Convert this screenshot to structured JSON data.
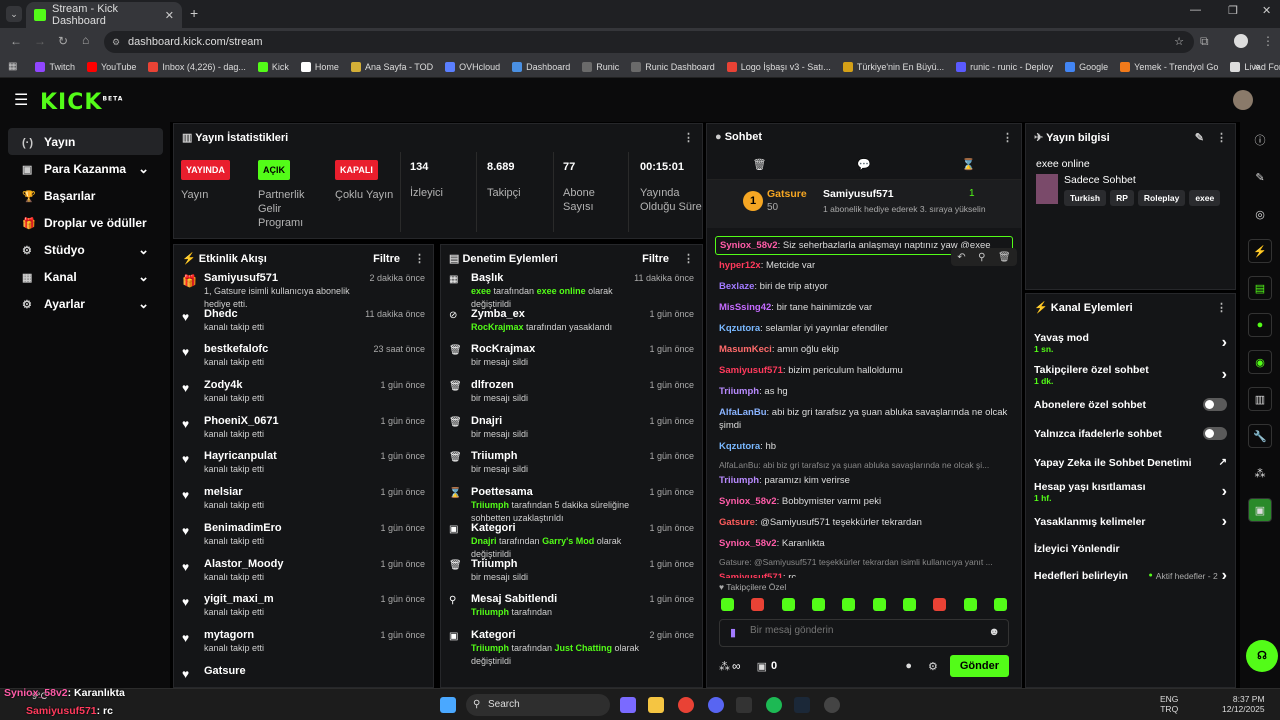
{
  "browser": {
    "tab_title": "Stream - Kick Dashboard",
    "url": "dashboard.kick.com/stream",
    "bookmarks": [
      "Twitch",
      "YouTube",
      "Inbox (4,226) - dag...",
      "Kick",
      "Home",
      "Ana Sayfa - TOD",
      "OVHcloud",
      "Dashboard",
      "Runic",
      "Runic Dashboard",
      "Logo İşbaşı v3 - Satı...",
      "Türkiye'nin En Büyü...",
      "runic - runic - Deploy",
      "Google",
      "Yemek - Trendyol Go",
      "Livad For Streamers"
    ]
  },
  "kick": {
    "logo": "KICK",
    "logo_sup": "BETA"
  },
  "sidebar": [
    "Yayın",
    "Para Kazanma",
    "Başarılar",
    "Droplar ve ödüller",
    "Stüdyo",
    "Kanal",
    "Ayarlar"
  ],
  "stats": {
    "title": "Yayın İstatistikleri",
    "badges": [
      {
        "badge": "YAYINDA",
        "label": "Yayın"
      },
      {
        "badge": "AÇIK",
        "label": "Partnerlik Gelir Programı"
      },
      {
        "badge": "KAPALI",
        "label": "Çoklu Yayın"
      }
    ],
    "numbers": [
      {
        "value": "134",
        "label": "İzleyici"
      },
      {
        "value": "8.689",
        "label": "Takipçi"
      },
      {
        "value": "77",
        "label": "Abone Sayısı"
      },
      {
        "value": "00:15:01",
        "label": "Yayında Olduğu Süre"
      }
    ]
  },
  "activity": {
    "title": "Etkinlik Akışı",
    "filter": "Filtre",
    "items": [
      {
        "name": "Samiyusuf571",
        "sub": "1, Gatsure isimli kullanıcıya abonelik hediye etti.",
        "time": "2 dakika önce"
      },
      {
        "name": "Dhedc",
        "sub": "kanalı takip etti",
        "time": "11 dakika önce"
      },
      {
        "name": "bestkefalofc",
        "sub": "kanalı takip etti",
        "time": "23 saat önce"
      },
      {
        "name": "Zody4k",
        "sub": "kanalı takip etti",
        "time": "1 gün önce"
      },
      {
        "name": "PhoeniX_0671",
        "sub": "kanalı takip etti",
        "time": "1 gün önce"
      },
      {
        "name": "Hayricanpulat",
        "sub": "kanalı takip etti",
        "time": "1 gün önce"
      },
      {
        "name": "melsiar",
        "sub": "kanalı takip etti",
        "time": "1 gün önce"
      },
      {
        "name": "BenimadimEro",
        "sub": "kanalı takip etti",
        "time": "1 gün önce"
      },
      {
        "name": "Alastor_Moody",
        "sub": "kanalı takip etti",
        "time": "1 gün önce"
      },
      {
        "name": "yigit_maxi_m",
        "sub": "kanalı takip etti",
        "time": "1 gün önce"
      },
      {
        "name": "mytagorn",
        "sub": "kanalı takip etti",
        "time": "1 gün önce"
      },
      {
        "name": "Gatsure",
        "sub": "",
        "time": ""
      }
    ]
  },
  "moderation": {
    "title": "Denetim Eylemleri",
    "filter": "Filtre",
    "items": [
      {
        "icon": "▦",
        "name": "Başlık",
        "pre": "exee",
        "mid": " tarafından ",
        "post": "exee online",
        "tail": " olarak değiştirildi",
        "time": "11 dakika önce"
      },
      {
        "icon": "⊘",
        "name": "Zymba_ex",
        "pre": "RocKrajmax",
        "mid": " tarafından yasaklandı",
        "post": "",
        "tail": "",
        "time": "1 gün önce"
      },
      {
        "icon": "🗑",
        "name": "RocKrajmax",
        "pre": "",
        "mid": "bir mesajı sildi",
        "post": "",
        "tail": "",
        "time": "1 gün önce"
      },
      {
        "icon": "🗑",
        "name": "dlfrozen",
        "pre": "",
        "mid": "bir mesajı sildi",
        "post": "",
        "tail": "",
        "time": "1 gün önce"
      },
      {
        "icon": "🗑",
        "name": "Dnajri",
        "pre": "",
        "mid": "bir mesajı sildi",
        "post": "",
        "tail": "",
        "time": "1 gün önce"
      },
      {
        "icon": "🗑",
        "name": "Triiumph",
        "pre": "",
        "mid": "bir mesajı sildi",
        "post": "",
        "tail": "",
        "time": "1 gün önce"
      },
      {
        "icon": "⌛",
        "name": "Poettesama",
        "pre": "Triiumph",
        "mid": " tarafından 5 dakika süreliğine sohbetten uzaklaştırıldı",
        "post": "",
        "tail": "",
        "time": "1 gün önce"
      },
      {
        "icon": "▣",
        "name": "Kategori",
        "pre": "Dnajri",
        "mid": " tarafından ",
        "post": "Garry's Mod",
        "tail": " olarak değiştirildi",
        "time": "1 gün önce"
      },
      {
        "icon": "🗑",
        "name": "Triiumph",
        "pre": "",
        "mid": "bir mesajı sildi",
        "post": "",
        "tail": "",
        "time": "1 gün önce"
      },
      {
        "icon": "⚲",
        "name": "Mesaj Sabitlendi",
        "pre": "Triiumph",
        "mid": " tarafından",
        "post": "",
        "tail": "",
        "time": "1 gün önce"
      },
      {
        "icon": "▣",
        "name": "Kategori",
        "pre": "Triiumph",
        "mid": " tarafından ",
        "post": "Just Chatting",
        "tail": " olarak değiştirildi",
        "time": "2 gün önce"
      }
    ]
  },
  "chat": {
    "title": "Sohbet",
    "pinned": {
      "rank": "1",
      "name": "Gatsure",
      "count": "50",
      "gifter": "Samiyusuf571",
      "gift_count": "1",
      "gift_text": "1 abonelik hediye ederek 3. sıraya yükselin"
    },
    "messages": [
      {
        "user": "Syniox_58v2",
        "color": "#ff5ca8",
        "text": "Siz seherbazlarla anlaşmayı naptınız yaw @exee"
      },
      {
        "user": "hyper12x",
        "color": "#ff3a5c",
        "text": "Metcide var"
      },
      {
        "user": "Bexlaze",
        "color": "#a27bff",
        "text": "biri de trip atıyor"
      },
      {
        "user": "MisSsing42",
        "color": "#c56bff",
        "text": "bir tane hainimizde var"
      },
      {
        "user": "Kqzutora",
        "color": "#7ab8ff",
        "text": "selamlar iyi yayınlar efendiler"
      },
      {
        "user": "MasumKeci",
        "color": "#ff6b6b",
        "text": "amın oğlu ekip"
      },
      {
        "user": "Samiyusuf571",
        "color": "#ff3a5c",
        "text": "bizim periculum halloldumu"
      },
      {
        "user": "Triiumph",
        "color": "#b98bff",
        "text": "as hg"
      },
      {
        "user": "AlfaLanBu",
        "color": "#8ab4ff",
        "text": "abi biz gri tarafsız ya şuan abluka savaşlarında ne olcak şimdi"
      },
      {
        "user": "Kqzutora",
        "color": "#7ab8ff",
        "text": "hb"
      },
      {
        "user": "Triiumph",
        "color": "#b98bff",
        "text": "paramızı kim verirse",
        "reply": "AlfaLanBu: abi biz gri tarafsız ya şuan abluka savaşlarında ne olcak şi..."
      },
      {
        "user": "Syniox_58v2",
        "color": "#ff5ca8",
        "text": "Bobbymister varmı peki"
      },
      {
        "user": "Gatsure",
        "color": "#ff5c5c",
        "text": "@Samiyusuf571 teşekkürler tekrardan"
      },
      {
        "user": "Syniox_58v2",
        "color": "#ff5ca8",
        "text": "Karanlıkta"
      },
      {
        "user": "Samiyusuf571",
        "color": "#ff3a5c",
        "text": "rc",
        "reply": "Gatsure: @Samiyusuf571 teşekkürler tekrardan isimli kullanıcıya yanıt ..."
      }
    ],
    "followers_label": "Takipçilere Özel",
    "input_placeholder": "Bir mesaj gönderin",
    "infinity": "∞",
    "chest_count": "0",
    "send": "Gönder"
  },
  "stream_info": {
    "title": "Yayın bilgisi",
    "stream_title": "exee online",
    "category": "Sadece Sohbet",
    "tags": [
      "Turkish",
      "RP",
      "Roleplay",
      "exee"
    ]
  },
  "channel_actions": {
    "title": "Kanal Eylemleri",
    "rows": [
      {
        "label": "Yavaş mod",
        "sub": "1 sn.",
        "kind": "arrow"
      },
      {
        "label": "Takipçilere özel sohbet",
        "sub": "1 dk.",
        "kind": "arrow"
      },
      {
        "label": "Abonelere özel sohbet",
        "sub": "",
        "kind": "toggle"
      },
      {
        "label": "Yalnızca ifadelerle sohbet",
        "sub": "",
        "kind": "toggle"
      },
      {
        "label": "Yapay Zeka ile Sohbet Denetimi",
        "sub": "",
        "kind": "ext"
      },
      {
        "label": "Hesap yaşı kısıtlaması",
        "sub": "1 hf.",
        "kind": "arrow"
      },
      {
        "label": "Yasaklanmış kelimeler",
        "sub": "",
        "kind": "arrow"
      },
      {
        "label": "İzleyici Yönlendir",
        "sub": "",
        "kind": "none"
      },
      {
        "label": "Hedefleri belirleyin",
        "sub": "",
        "kind": "goal",
        "extra": "Aktif hedefler - 2"
      }
    ]
  },
  "overlay": {
    "line1_user": "Syniox_58v2",
    "line1_text": ": Karanlıkta",
    "line2_user": "Samiyusuf571",
    "line2_text": ": rc",
    "weather": "9°C"
  },
  "taskbar": {
    "search": "Search",
    "lang": "ENG",
    "lang2": "TRQ",
    "time": "8:37 PM",
    "date": "12/12/2025"
  }
}
